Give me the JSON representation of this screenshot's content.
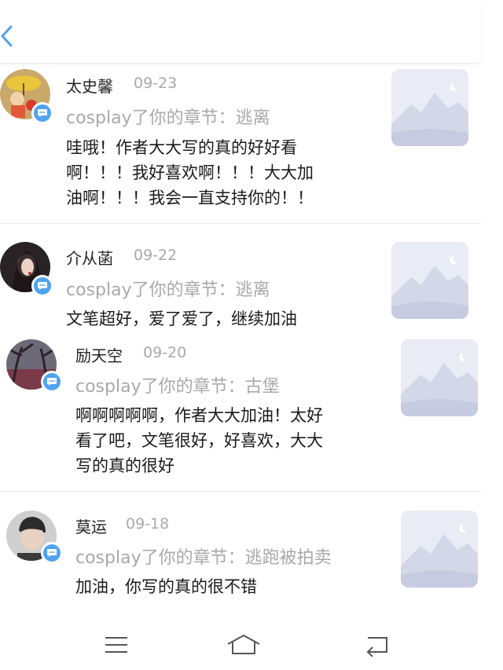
{
  "comments": [
    {
      "name": "太史馨",
      "date": "09-23",
      "chapter": "cosplay了你的章节：逃离",
      "content_lines": [
        "哇哦！作者大大写的真的好好看",
        "啊！！！我好喜欢啊！！！大大加",
        "油啊！！！我会一直支持你的！！"
      ]
    },
    {
      "name": "介从菡",
      "date": "09-22",
      "chapter": "cosplay了你的章节：逃离",
      "content_lines": [
        "文笔超好，爱了爱了，继续加油"
      ]
    },
    {
      "name": "励天空",
      "date": "09-20",
      "chapter": "cosplay了你的章节：古堡",
      "content_lines": [
        "啊啊啊啊啊，作者大大加油！太好",
        "看了吧，文笔很好，好喜欢，大大",
        "写的真的很好"
      ]
    },
    {
      "name": "莫运",
      "date": "09-18",
      "chapter": "cosplay了你的章节：逃跑被拍卖",
      "content_lines": [
        "加油，你写的真的很不错"
      ]
    }
  ],
  "icons": {
    "back": "chevron-left-icon",
    "badge": "comment-bubble-icon",
    "thumbnail": "image-placeholder-icon",
    "nav_menu": "menu-icon",
    "nav_home": "home-icon",
    "nav_back": "return-icon"
  },
  "colors": {
    "accent": "#4fa3f0",
    "muted_text": "#a8a8a8",
    "thumb_bg": "#e9ebf5"
  }
}
